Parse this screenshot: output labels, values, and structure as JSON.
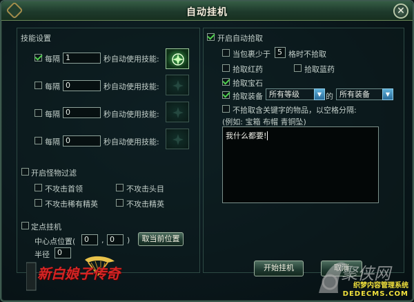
{
  "window": {
    "title": "自动挂机",
    "close_glyph": "✕"
  },
  "skills": {
    "header": "技能设置",
    "every_label": "每隔",
    "suffix": "秒自动使用技能:",
    "rows": [
      {
        "checked": true,
        "value": "1",
        "has_skill": true
      },
      {
        "checked": false,
        "value": "0",
        "has_skill": false
      },
      {
        "checked": false,
        "value": "0",
        "has_skill": false
      },
      {
        "checked": false,
        "value": "0",
        "has_skill": false
      }
    ]
  },
  "monster_filter": {
    "header": "开启怪物过滤",
    "options": [
      "不攻击首领",
      "不攻击头目",
      "不攻击稀有精英",
      "不攻击精英"
    ]
  },
  "fixed_point": {
    "header": "定点挂机",
    "center_label": "中心点位置(",
    "x": "0",
    "comma": ",",
    "y": "0",
    "close_paren": ")",
    "get_position_button": "取当前位置",
    "radius_label": "半径",
    "radius": "0"
  },
  "pickup": {
    "header": "开启自动拾取",
    "bag_label_prefix": "当包裹少于",
    "bag_value": "5",
    "bag_label_suffix": "格时不拾取",
    "red_potion": "拾取红药",
    "blue_potion": "拾取蓝药",
    "gems": "拾取宝石",
    "equipment": "拾取装备",
    "level_select": "所有等级",
    "of_label": "的",
    "type_select": "所有装备",
    "keyword_label": "不拾取含关键字的物品，以空格分隔:",
    "example_label": "(例如: 宝箱 布帽 青铜坠)",
    "keyword_text": "我什么都要!",
    "checked": {
      "header": true,
      "bag": false,
      "red": false,
      "blue": false,
      "gems": true,
      "equip": true,
      "keyword": false
    }
  },
  "footer": {
    "start_button": "开始挂机",
    "close_button": "取消",
    "logo_text": "新白娘子传奇",
    "watermark_site": "聚侠网",
    "watermark_line1": "织梦内容管理系统",
    "watermark_line2": "DEDECMS.COM"
  },
  "icons": {
    "close": "close-icon",
    "skill": "skill-glyph-icon",
    "dropdown": "chevron-down-icon",
    "logo": "game-logo"
  }
}
